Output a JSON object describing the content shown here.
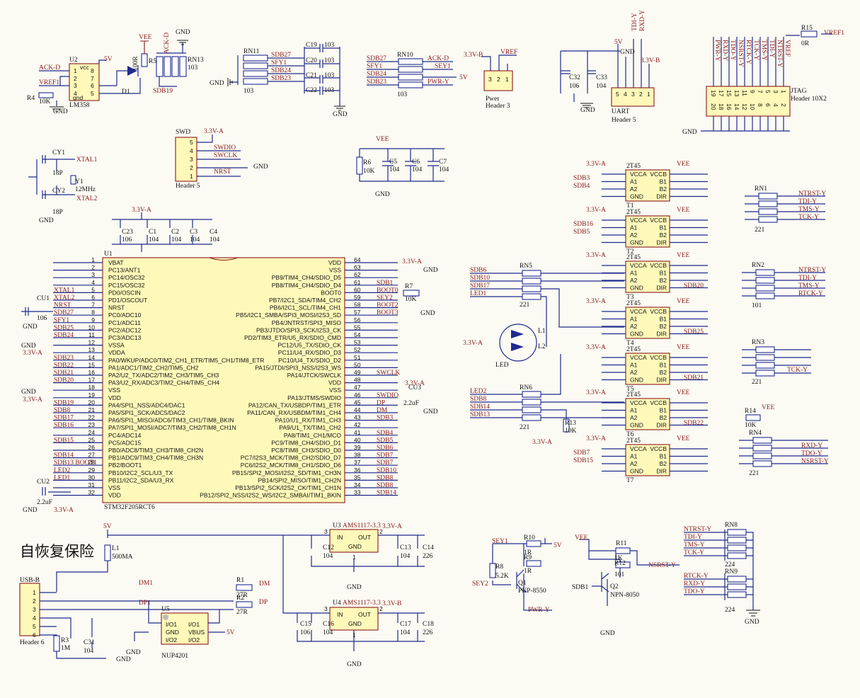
{
  "title": "自恢复保险",
  "mcu": {
    "name": "U1",
    "part": "STM32F205RCT6",
    "left_pins": [
      {
        "n": "1",
        "f": "VBAT",
        "net": ""
      },
      {
        "n": "2",
        "f": "PC13/ANT1",
        "net": ""
      },
      {
        "n": "3",
        "f": "PC14/OSC32",
        "net": ""
      },
      {
        "n": "4",
        "f": "PC15/OSC32",
        "net": ""
      },
      {
        "n": "5",
        "f": "PD0/OSCIN",
        "net": "XTAL1"
      },
      {
        "n": "6",
        "f": "PD1/OSCOUT",
        "net": "XTAL2"
      },
      {
        "n": "7",
        "f": "NRST",
        "net": "NRST"
      },
      {
        "n": "8",
        "f": "PC0/ADC10",
        "net": "SDB27"
      },
      {
        "n": "9",
        "f": "PC1/ADC11",
        "net": "SFY1"
      },
      {
        "n": "10",
        "f": "PC2/ADC12",
        "net": "SDB25"
      },
      {
        "n": "11",
        "f": "PC3/ADC13",
        "net": "SDB24"
      },
      {
        "n": "12",
        "f": "VSSA",
        "net": ""
      },
      {
        "n": "13",
        "f": "VDDA",
        "net": ""
      },
      {
        "n": "14",
        "f": "PA0/WKUP/ADC0/TIM2_CH1_ETR/TIM5_CH1/TIM8_ETR",
        "net": "SDB23"
      },
      {
        "n": "15",
        "f": "PA1/ADC1/TIM2_CH2/TIM5_CH2",
        "net": "SDB22"
      },
      {
        "n": "16",
        "f": "PA2/U2_TX/ADC2/TIM2_CH3/TIM5_CH3",
        "net": "SDB21"
      },
      {
        "n": "17",
        "f": "PA3/U2_RX/ADC3/TIM2_CH4/TIM5_CH4",
        "net": "SDB20"
      },
      {
        "n": "18",
        "f": "VSS",
        "net": ""
      },
      {
        "n": "19",
        "f": "VDD",
        "net": ""
      },
      {
        "n": "20",
        "f": "PA4/SPI1_NSS/ADC4/DAC1",
        "net": "SDB19"
      },
      {
        "n": "21",
        "f": "PA5/SPI1_SCK/ADC5/DAC2",
        "net": "SDB8"
      },
      {
        "n": "22",
        "f": "PA6/SPI1_MISO/ADC6/TIM3_CH1/TIM8_BKIN",
        "net": "SDB17"
      },
      {
        "n": "23",
        "f": "PA7/SPI1_MOSI/ADC7/TIM3_CH2/TIM8_CH1N",
        "net": "SDB16"
      },
      {
        "n": "24",
        "f": "PC4/ADC14",
        "net": ""
      },
      {
        "n": "25",
        "f": "PC5/ADC15",
        "net": "SDB15"
      },
      {
        "n": "26",
        "f": "PB0/ADC8/TIM3_CH3/TIM8_CH2N",
        "net": ""
      },
      {
        "n": "27",
        "f": "PB1/ADC9/TIM3_CH4/TIM8_CH3N",
        "net": "SDB14"
      },
      {
        "n": "28",
        "f": "PB2/BOOT1",
        "net": "SDB13 BOOT1"
      },
      {
        "n": "29",
        "f": "PB10/I2C2_SCL/U3_TX",
        "net": "LED2"
      },
      {
        "n": "30",
        "f": "PB11/I2C2_SDA/U3_RX",
        "net": "LED1"
      },
      {
        "n": "31",
        "f": "VSS",
        "net": ""
      },
      {
        "n": "32",
        "f": "VDD",
        "net": ""
      }
    ],
    "right_pins": [
      {
        "n": "64",
        "f": "VDD",
        "net": ""
      },
      {
        "n": "63",
        "f": "VSS",
        "net": ""
      },
      {
        "n": "62",
        "f": "PB9/TIM4_CH4/SDIO_D5",
        "net": ""
      },
      {
        "n": "61",
        "f": "PB8/TIM4_CH4/SDIO_D4",
        "net": "SDB1"
      },
      {
        "n": "60",
        "f": "BOOT0",
        "net": "BOOT0"
      },
      {
        "n": "59",
        "f": "PB7/I2C1_SDA/TIM4_CH2",
        "net": "SEY2"
      },
      {
        "n": "58",
        "f": "PB6/I2C1_SCL/TIM4_CH1",
        "net": "BOOT2"
      },
      {
        "n": "57",
        "f": "PB5/I2C1_SMBA/SPI3_MOSI/I2S3_SD",
        "net": "BOOT3"
      },
      {
        "n": "56",
        "f": "PB4/JNTRST/SPI3_MISO",
        "net": ""
      },
      {
        "n": "55",
        "f": "PB3/JTDO/SPI3_SCK/I2S3_CK",
        "net": ""
      },
      {
        "n": "54",
        "f": "PD2/TIM3_ETR/U5_RX/SDIO_CMD",
        "net": ""
      },
      {
        "n": "53",
        "f": "PC12/U5_TX/SDIO_CK",
        "net": ""
      },
      {
        "n": "52",
        "f": "PC11/U4_RX/SDIO_D3",
        "net": ""
      },
      {
        "n": "51",
        "f": "PC10/U4_TX/SDIO_D2",
        "net": ""
      },
      {
        "n": "50",
        "f": "PA15/JTDI/SPI3_NSS/I2S3_WS",
        "net": ""
      },
      {
        "n": "49",
        "f": "PA14/JTCK/SWCLK",
        "net": "SWCLK"
      },
      {
        "n": "48",
        "f": "VDD",
        "net": ""
      },
      {
        "n": "47",
        "f": "VSS",
        "net": ""
      },
      {
        "n": "46",
        "f": "PA13/JTMS/SWDIO",
        "net": "SWDIO"
      },
      {
        "n": "45",
        "f": "PA12/CAN_TX/USBDP/TIM1_ETR",
        "net": "DP"
      },
      {
        "n": "44",
        "f": "PA11/CAN_RX/USBDM/TIM1_CH4",
        "net": "DM"
      },
      {
        "n": "43",
        "f": "PA10/U1_RX/TIM1_CH3",
        "net": "SDB3"
      },
      {
        "n": "42",
        "f": "PA9/U1_TX/TIM1_CH2",
        "net": ""
      },
      {
        "n": "41",
        "f": "PA8/TIM1_CH1/MCO",
        "net": "SDB4"
      },
      {
        "n": "40",
        "f": "PC9/TIM8_CH4/SDIO_D1",
        "net": "SDB5"
      },
      {
        "n": "39",
        "f": "PC8/TIM8_CH3/SDIO_D0",
        "net": "SDB6"
      },
      {
        "n": "38",
        "f": "PC7/I2S3_MCK/TIM8_CH2/SDIO_D7",
        "net": "SDB7"
      },
      {
        "n": "37",
        "f": "PC6/I2S2_MCK/TIM8_CH1/SDIO_D6",
        "net": "SDB7"
      },
      {
        "n": "36",
        "f": "PB15/SPI2_MOSI/I2S2_SD/TIM1_CH3N",
        "net": "SDB10"
      },
      {
        "n": "35",
        "f": "PB14/SPI2_MISO/TIM1_CH2N",
        "net": "SDB8"
      },
      {
        "n": "34",
        "f": "PB13/SPI2_SCK/I2S2_CK/TIM1_CH1N",
        "net": "SDB8"
      },
      {
        "n": "33",
        "f": "PB12/SPI2_NSS/I2S2_WS/I2C2_SMBAI/TIM1_BKIN",
        "net": "SDB14"
      }
    ]
  },
  "buffers": [
    {
      "name": "T1",
      "part": "2T45",
      "in": [
        "SDB3",
        "SDB4"
      ],
      "pins": [
        "VCCA",
        "VCCB",
        "A1",
        "B1",
        "A2",
        "B2",
        "GND",
        "DIR"
      ],
      "pwr_a": "3.3V-A",
      "pwr_b": "VEE"
    },
    {
      "name": "T2",
      "part": "2T45",
      "in": [
        "SDB16",
        "SDB5"
      ],
      "pins": [
        "VCCA",
        "VCCB",
        "A1",
        "B1",
        "A2",
        "B2",
        "GND",
        "DIR"
      ],
      "pwr_a": "3.3V-A",
      "pwr_b": "VEE"
    },
    {
      "name": "T3",
      "part": "2T45",
      "in": [
        "",
        ""
      ],
      "pins": [
        "VCCA",
        "VCCB",
        "A1",
        "B1",
        "A2",
        "B2",
        "GND",
        "DIR"
      ],
      "pwr_a": "3.3V-A",
      "pwr_b": "VEE",
      "out": "SDB20"
    },
    {
      "name": "T4",
      "part": "2T45",
      "in": [
        "",
        ""
      ],
      "pins": [
        "VCCA",
        "VCCB",
        "A1",
        "B1",
        "A2",
        "B2",
        "GND",
        "DIR"
      ],
      "pwr_a": "3.3V-A",
      "pwr_b": "VEE",
      "out": "SDB25"
    },
    {
      "name": "T5",
      "part": "2T45",
      "in": [
        "",
        ""
      ],
      "pins": [
        "VCCA",
        "VCCB",
        "A1",
        "B1",
        "A2",
        "B2",
        "GND",
        "DIR"
      ],
      "pwr_a": "3.3V-A",
      "pwr_b": "VEE",
      "out": "SDB21"
    },
    {
      "name": "T6",
      "part": "2T45",
      "in": [
        "",
        ""
      ],
      "pins": [
        "VCCA",
        "VCCB",
        "A1",
        "B1",
        "A2",
        "B2",
        "GND",
        "DIR"
      ],
      "pwr_a": "3.3V-A",
      "pwr_b": "VEE",
      "out": "SDB22"
    },
    {
      "name": "T7",
      "part": "2T45",
      "in": [
        "SDB7",
        "SDB15"
      ],
      "pins": [
        "VCCA",
        "VCCB",
        "A1",
        "B1",
        "A2",
        "B2",
        "GND",
        "DIR"
      ],
      "pwr_a": "3.3V-A",
      "pwr_b": "VEE"
    }
  ],
  "labels": {
    "gnd": "GND",
    "vee": "VEE",
    "v5": "5V",
    "v33a": "3.3V-A",
    "v33b": "3.3V-B",
    "vref": "VREF",
    "vref1": "VREF1",
    "u2": "U2",
    "u2_part": "LM358",
    "u2_pin": [
      "1",
      "2",
      "3",
      "4",
      "8",
      "7",
      "6",
      "5"
    ],
    "vcc": "vcc",
    "gnd_lc": "gnd",
    "ackd": "ACK-D",
    "r4": "R4",
    "r4v": "10K",
    "r5": "R5",
    "r5v": "100R",
    "d1": "D1",
    "rn13": "RN13",
    "rn13v": "103",
    "sdb19": "SDB19",
    "rn11": "RN11",
    "rn11v": "103",
    "sdb27": "SDB27",
    "sfy1": "SFY1",
    "sdb24": "SDB24",
    "sdb23": "SDB23",
    "c19": "C19",
    "c20": "C20",
    "c21": "C21",
    "c22": "C22",
    "c103": "103",
    "rn10": "RN10",
    "rn10v": "103",
    "sey1": "SEY1",
    "pwry": "PWR-Y",
    "pwer": "Pwer",
    "header3": "Header 3",
    "h3pins": [
      "3",
      "2",
      "1"
    ],
    "c32": "C32",
    "c32v": "106",
    "c33": "C33",
    "c33v": "104",
    "uart": "UART",
    "header5": "Header 5",
    "tdiy": "TDI-Y",
    "rxdy": "RXD-Y",
    "h5pins": [
      "5",
      "4",
      "3",
      "2",
      "1"
    ],
    "r15": "R15",
    "r15v": "0R",
    "jtag": "JTAG",
    "header10x2": "Header 10X2",
    "jtag_top": [
      "PWR-Y",
      "RXD-Y",
      "TDO-Y",
      "NSRST-Y",
      "RTCK-Y",
      "TCK-Y",
      "TMS-Y",
      "TDI-Y",
      "NTRST-Y",
      "VREF"
    ],
    "jtag_pins_a": [
      "19",
      "17",
      "15",
      "13",
      "11",
      "9",
      "7",
      "5",
      "3",
      "1"
    ],
    "jtag_pins_b": [
      "20",
      "18",
      "16",
      "14",
      "12",
      "10",
      "8",
      "6",
      "4",
      "2"
    ],
    "cy1": "CY1",
    "cy1v": "18P",
    "cy2": "CY2",
    "cy2v": "18P",
    "y1": "Y1",
    "y1v": "12MHz",
    "xtal1": "XTAL1",
    "xtal2": "XTAL2",
    "swd": "SWD",
    "swdio": "SWDIO",
    "swclk": "SWCLK",
    "nrst": "NRST",
    "r6": "R6",
    "r6v": "10K",
    "c5": "C5",
    "c5v": "104",
    "c6": "C6",
    "c6v": "104",
    "c7": "C7",
    "c7v": "104",
    "c23": "C23",
    "c23v": "106",
    "c1": "C1",
    "c1v": "104",
    "c2": "C2",
    "c2v": "104",
    "c3": "C3",
    "c3v": "104",
    "c4": "C4",
    "c4v": "104",
    "cu1": "CU1",
    "cu1v": "106",
    "cu2": "CU2",
    "cu2v": "2.2uF",
    "cu3": "CU3",
    "cu3v": "2.2uF",
    "r7": "R7",
    "r7v": "10K",
    "boot0": "BOOT0",
    "rn5": "RN5",
    "rn5v": "221",
    "rn6": "RN6",
    "rn6v": "221",
    "rn1": "RN1",
    "rn1v": "221",
    "rn2": "RN2",
    "rn2v": "101",
    "rn3": "RN3",
    "rn3v": "221",
    "rn4": "RN4",
    "rn4v": "221",
    "rn8": "RN8",
    "rn8v": "224",
    "rn9": "RN9",
    "rn9v": "224",
    "rn5in": [
      "SDB6",
      "SDB10",
      "SDB17",
      "LED1"
    ],
    "rn6in": [
      "LED2",
      "SDB8",
      "SDB14",
      "SDB13"
    ],
    "rn1out": [
      "NTRST-Y",
      "TDI-Y",
      "TMS-Y",
      "TCK-Y"
    ],
    "rn2out": [
      "NTRST-Y",
      "TDI-Y",
      "TMS-Y",
      "RTCK-Y"
    ],
    "tcky": "TCK-Y",
    "rn4out": [
      "RXD-Y",
      "TDO-Y",
      "NSRST-Y"
    ],
    "rn8in": [
      "NTRST-Y",
      "TDI-Y",
      "TMS-Y",
      "TCK-Y"
    ],
    "rn9in": [
      "RTCK-Y",
      "RXD-Y",
      "TDO-Y"
    ],
    "l1": "L1",
    "l2": "L2",
    "led": "LED",
    "r13": "R13",
    "r13v": "10K",
    "r14": "R14",
    "r14v": "10K",
    "l1fuse": "L1",
    "l1fusev": "500MA",
    "usb": "USB-B",
    "header6": "Header 6",
    "h6pins": [
      "1",
      "2",
      "3",
      "4",
      "5",
      "6"
    ],
    "dm1": "DM1",
    "dp1": "DP1",
    "r1": "R1",
    "r1v": "27R",
    "r2": "R2",
    "r2v": "27R",
    "dm": "DM",
    "dp": "DP",
    "u5": "U5",
    "u5part": "NUP4201",
    "u5pins": [
      "I/O1",
      "GND",
      "I/O2",
      "I/O1",
      "VBUS",
      "I/O2"
    ],
    "r3": "R3",
    "r3v": "1M",
    "c31": "C31",
    "c31v": "104",
    "u3": "U3",
    "u3part": "AMS1117-3.3",
    "u4": "U4",
    "u4part": "AMS1117-3.3",
    "in": "IN",
    "out": "OUT",
    "c12": "C12",
    "c12v": "104",
    "c13": "C13",
    "c13v": "104",
    "c14": "C14",
    "c14v": "226",
    "c15": "C15",
    "c15v": "106",
    "c16": "C16",
    "c16v": "104",
    "c17": "C17",
    "c17v": "104",
    "c18": "C18",
    "c18v": "226",
    "reg_pins": [
      "3",
      "2",
      "1"
    ],
    "r10": "R10",
    "r10v": "1R",
    "r9": "R9",
    "r9v": "1R",
    "r8": "R8",
    "r8v": "5.2K",
    "q1": "Q1",
    "q1part": "PNP-8550",
    "sey2": "SEY2",
    "r11": "R11",
    "r11v": "1K",
    "r12": "R12",
    "r12v": "101",
    "q2": "Q2",
    "q2part": "NPN-8050",
    "sdb1": "SDB1",
    "nsrsty": "NSRST-Y"
  }
}
